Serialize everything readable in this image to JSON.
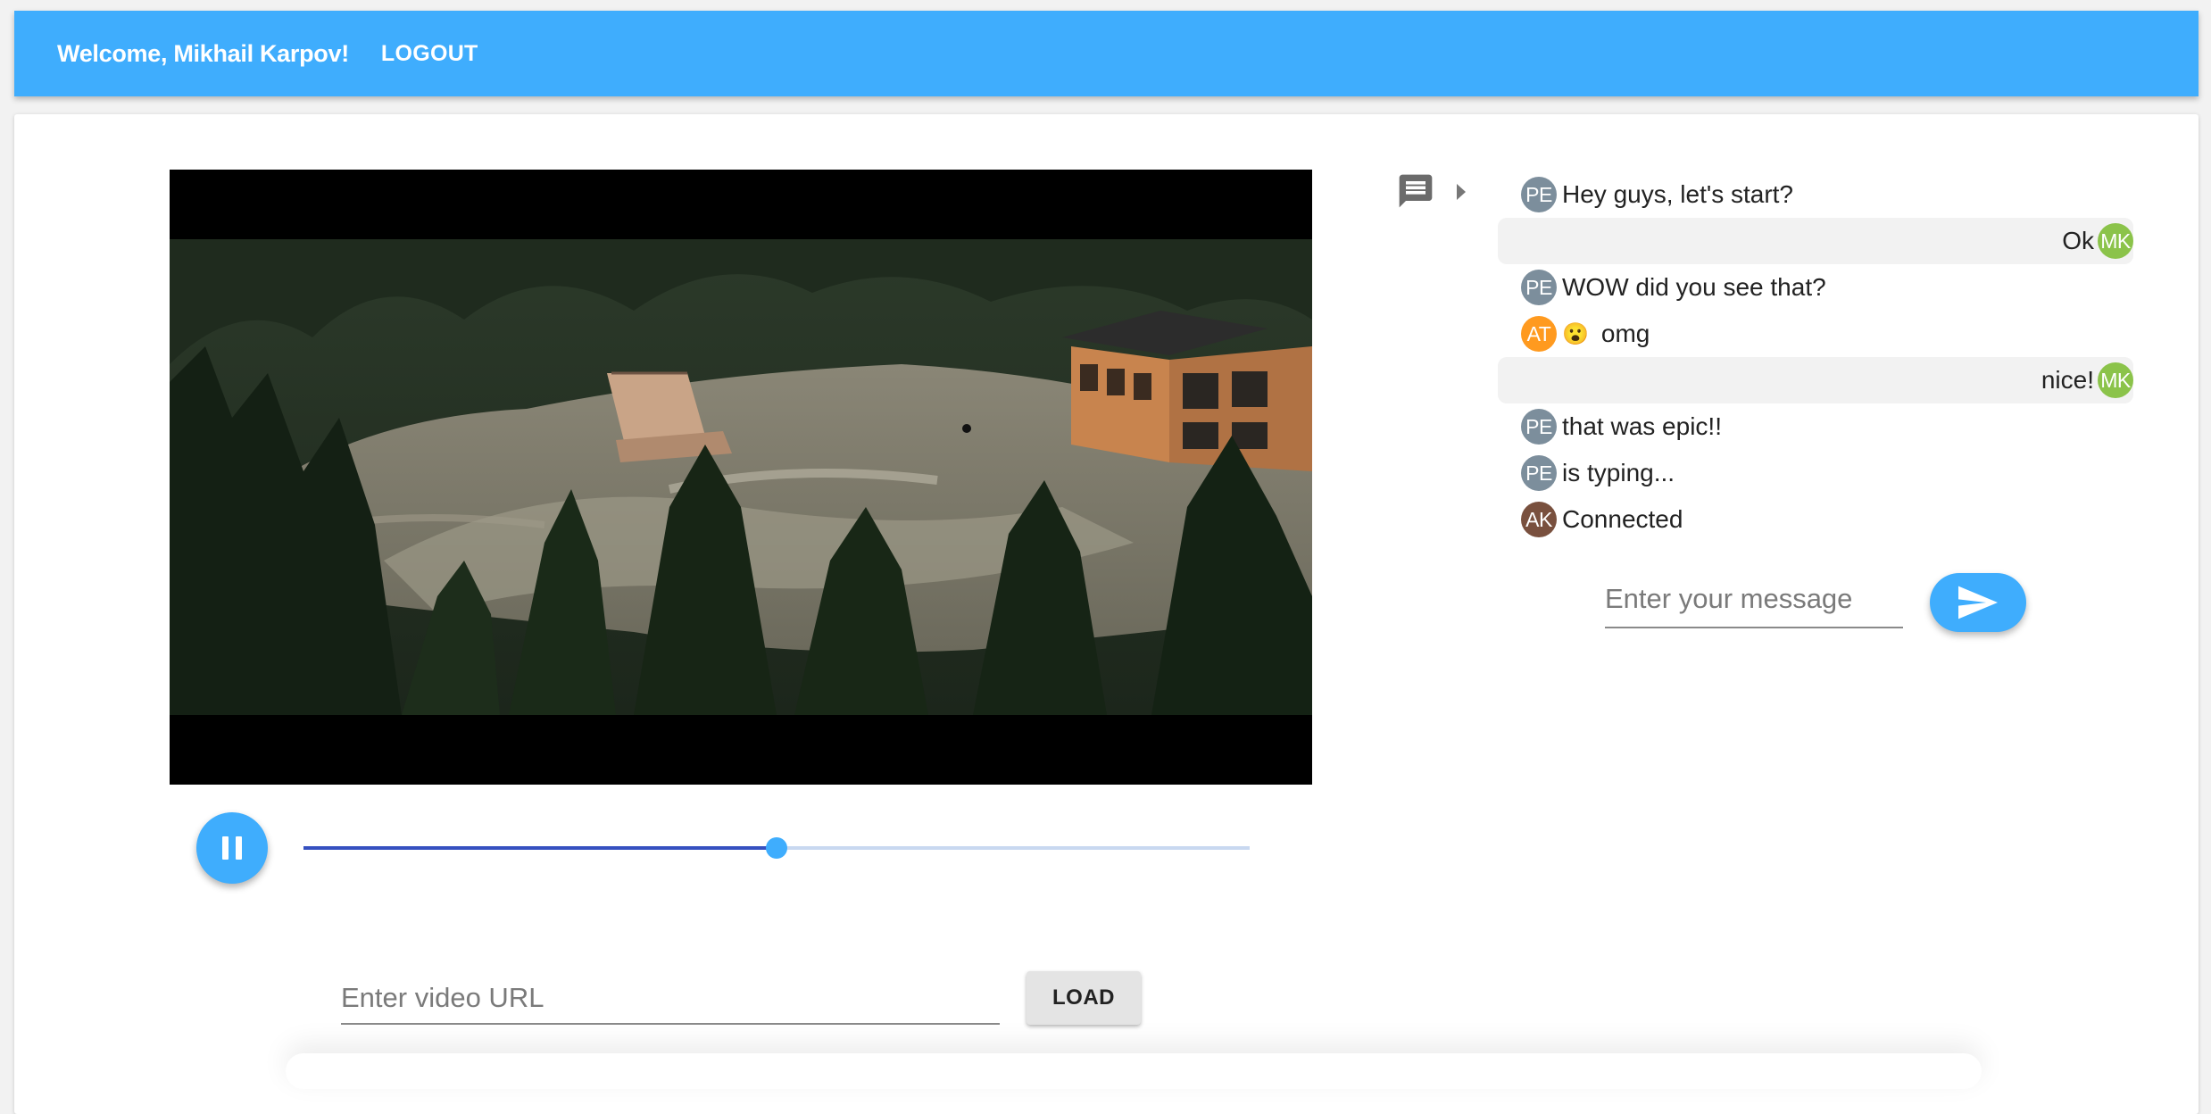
{
  "header": {
    "welcome": "Welcome, Mikhail Karpov!",
    "logout": "LOGOUT",
    "color": "#3fadfd"
  },
  "player": {
    "state": "playing",
    "progress": 0.5
  },
  "video_url": {
    "placeholder": "Enter video URL",
    "value": "",
    "button": "LOAD"
  },
  "chat": {
    "icon": "chat-message-icon",
    "toggle_icon": "caret-right-icon",
    "messages": [
      {
        "initials": "PE",
        "color": "#7c8e9c",
        "text": "Hey guys, let's start?",
        "own": false
      },
      {
        "initials": "MK",
        "color": "#8bc34a",
        "text": "Ok",
        "own": true
      },
      {
        "initials": "PE",
        "color": "#7c8e9c",
        "text": "WOW did you see that?",
        "own": false
      },
      {
        "initials": "AT",
        "color": "#ff9a1f",
        "emoji": "😮",
        "text": "omg",
        "own": false
      },
      {
        "initials": "MK",
        "color": "#8bc34a",
        "text": "nice!",
        "own": true
      },
      {
        "initials": "PE",
        "color": "#7c8e9c",
        "text": "that was epic!!",
        "own": false
      },
      {
        "initials": "PE",
        "color": "#7c8e9c",
        "text": "is typing...",
        "own": false
      },
      {
        "initials": "AK",
        "color": "#79503e",
        "text": "Connected",
        "own": false
      }
    ],
    "input_placeholder": "Enter your message",
    "input_value": "",
    "send_icon": "send-icon"
  }
}
